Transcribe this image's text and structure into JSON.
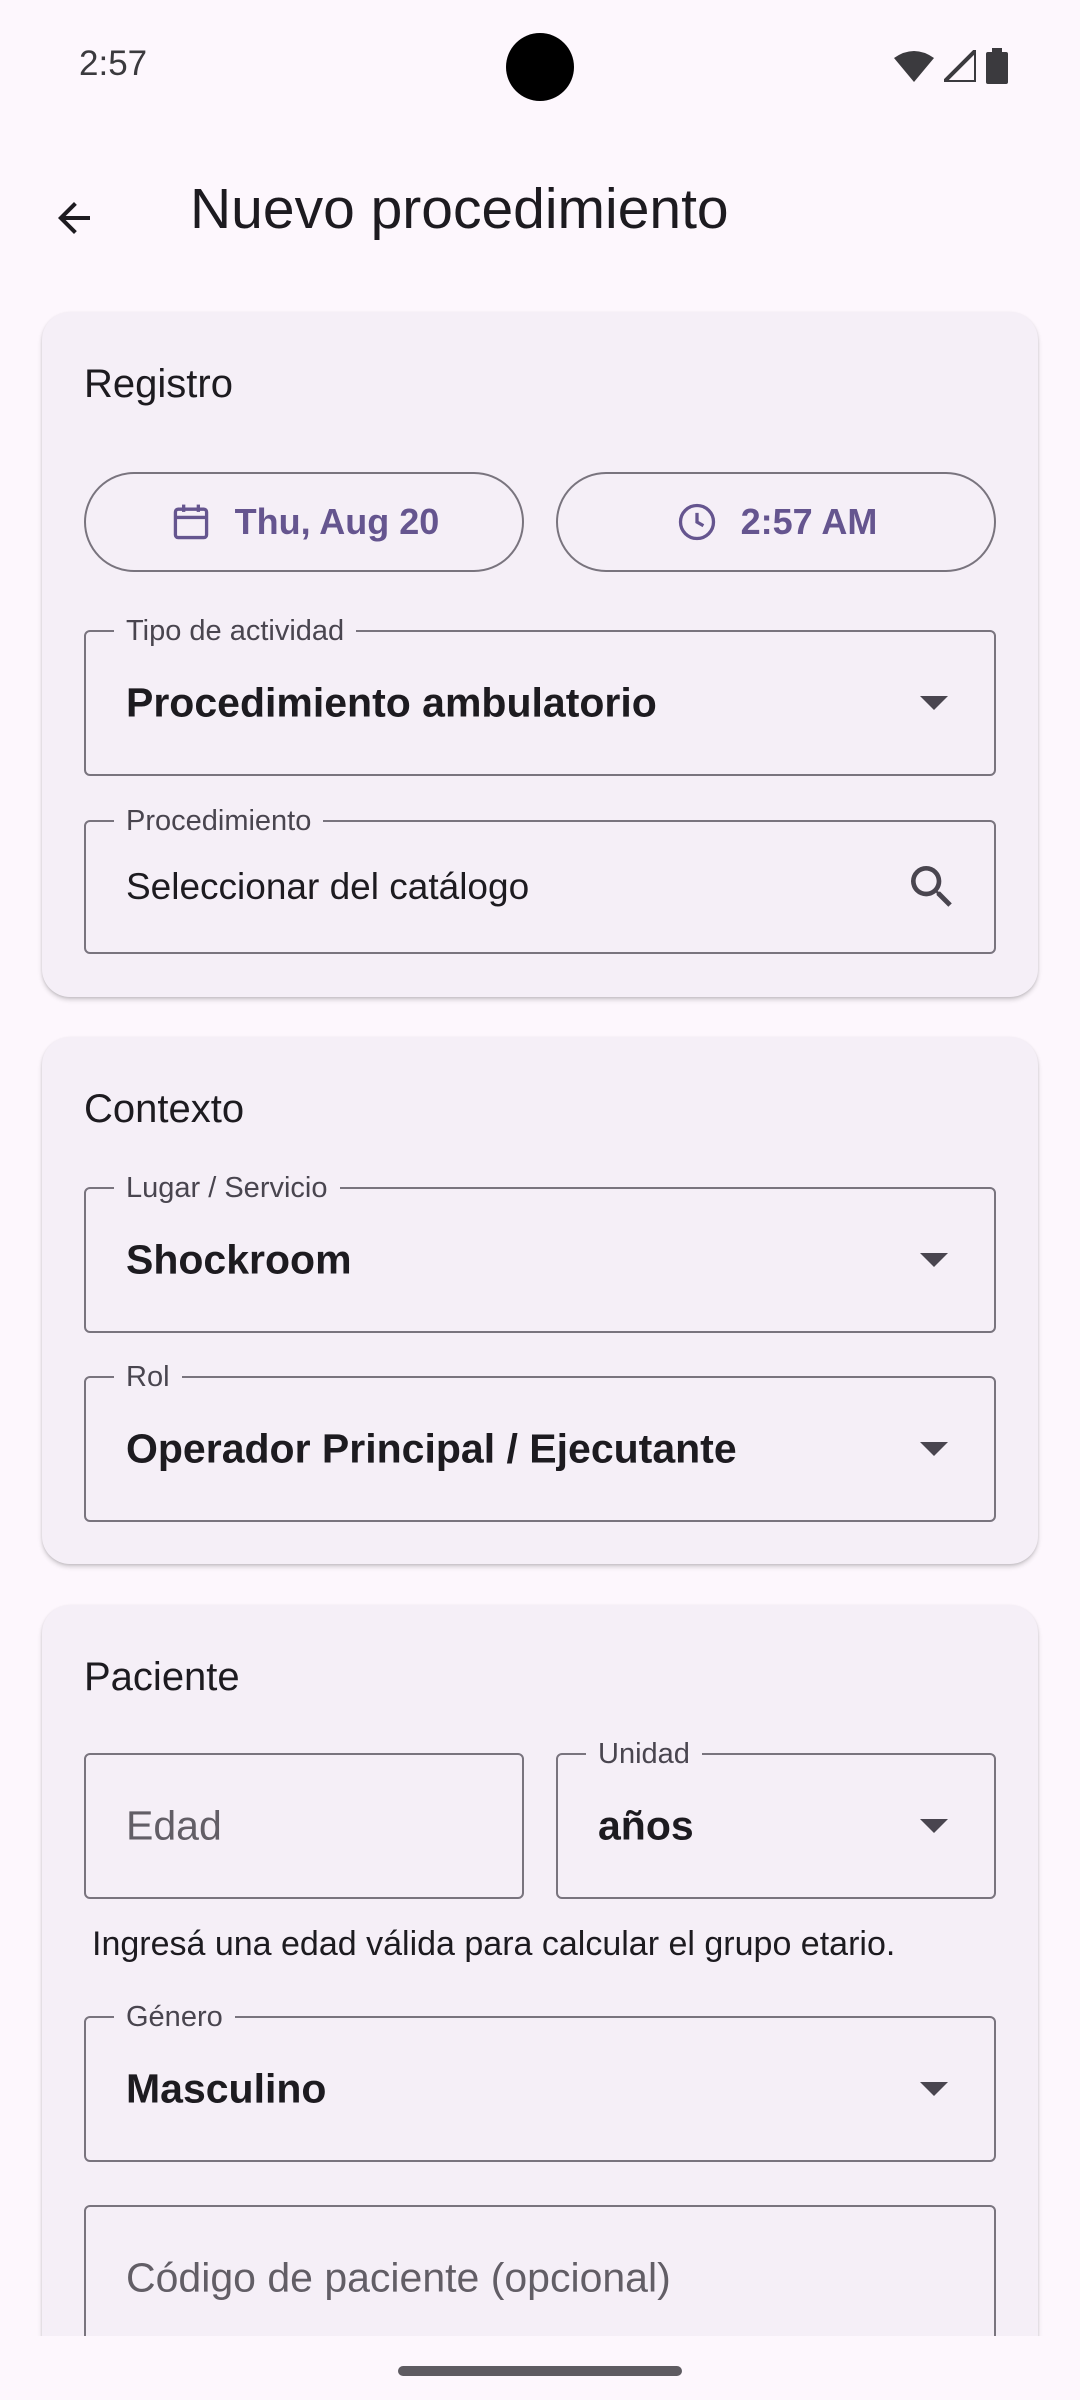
{
  "status_bar": {
    "time": "2:57"
  },
  "app_bar": {
    "title": "Nuevo procedimiento"
  },
  "registro": {
    "title": "Registro",
    "date": "Thu, Aug 20",
    "time": "2:57 AM",
    "tipo_actividad": {
      "label": "Tipo de actividad",
      "value": "Procedimiento ambulatorio"
    },
    "procedimiento": {
      "label": "Procedimiento",
      "value": "Seleccionar del catálogo"
    }
  },
  "contexto": {
    "title": "Contexto",
    "lugar": {
      "label": "Lugar / Servicio",
      "value": "Shockroom"
    },
    "rol": {
      "label": "Rol",
      "value": "Operador Principal / Ejecutante"
    }
  },
  "paciente": {
    "title": "Paciente",
    "edad": {
      "placeholder": "Edad"
    },
    "unidad": {
      "label": "Unidad",
      "value": "años"
    },
    "helper": "Ingresá una edad válida para calcular el grupo etario.",
    "genero": {
      "label": "Género",
      "value": "Masculino"
    },
    "codigo": {
      "placeholder": "Código de paciente (opcional)"
    }
  },
  "colors": {
    "accent": "#65558f",
    "background": "#fdf7fd",
    "card": "#f5eff7",
    "outline": "#79747e"
  },
  "icons": [
    "back-arrow-icon",
    "calendar-icon",
    "clock-icon",
    "search-icon",
    "dropdown-arrow-icon",
    "wifi-icon",
    "signal-icon",
    "battery-icon"
  ]
}
